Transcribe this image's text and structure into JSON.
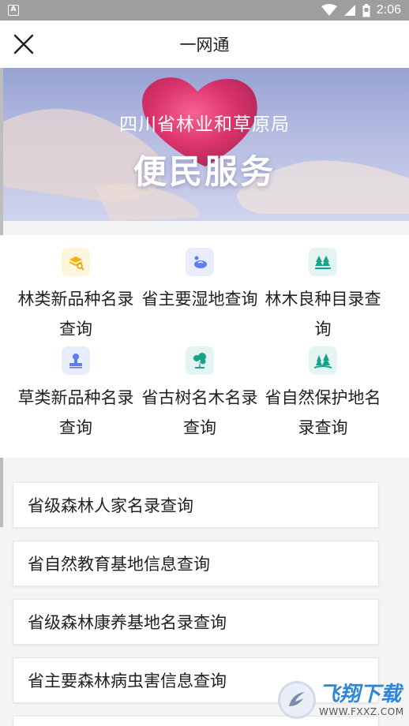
{
  "status_bar": {
    "notification": "A",
    "time": "2:06"
  },
  "header": {
    "title": "一网通"
  },
  "banner": {
    "org_name": "四川省林业和草原局",
    "slogan": "便民服务"
  },
  "grid": {
    "items": [
      {
        "label": "林类新品种名录查询",
        "icon": "seedling-search-icon",
        "color": "#f2b40c",
        "bg": "#fdf5dc"
      },
      {
        "label": "省主要湿地查询",
        "icon": "wetland-icon",
        "color": "#5d7cf0",
        "bg": "#e9edfb"
      },
      {
        "label": "林木良种目录查询",
        "icon": "trees-icon",
        "color": "#17a38a",
        "bg": "#e3f4f2"
      },
      {
        "label": "草类新品种名录查询",
        "icon": "stamp-icon",
        "color": "#5d7cf0",
        "bg": "#e9edfb"
      },
      {
        "label": "省古树名木名录查询",
        "icon": "ancient-tree-icon",
        "color": "#17a38a",
        "bg": "#e3f4f2"
      },
      {
        "label": "省自然保护地名录查询",
        "icon": "forest-reserve-icon",
        "color": "#17a38a",
        "bg": "#e3f4f2"
      }
    ]
  },
  "list": {
    "items": [
      {
        "label": "省级森林人家名录查询"
      },
      {
        "label": "省自然教育基地信息查询"
      },
      {
        "label": "省级森林康养基地名录查询"
      },
      {
        "label": "省主要森林病虫害信息查询"
      }
    ]
  },
  "watermark": {
    "cn": "飞翔下载",
    "en": "WWW.FXXZ.COM"
  }
}
